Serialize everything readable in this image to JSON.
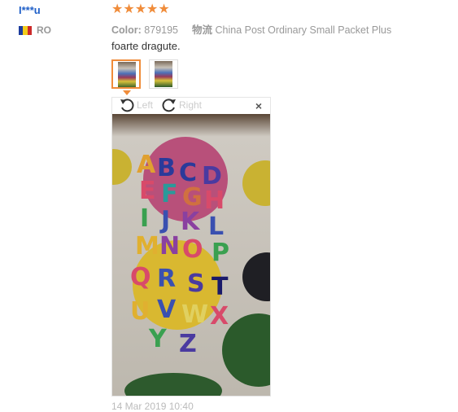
{
  "review": {
    "user_name": "I***u",
    "country_code": "RO",
    "flag_colors": [
      "#1d3c9e",
      "#f2cc1a",
      "#cc2a2a"
    ],
    "rating": 5,
    "star_color": "#f08c3a",
    "color_label": "Color:",
    "color_value": "879195",
    "shipping_label": "物流",
    "shipping_value": "China Post Ordinary Small Packet Plus",
    "text": "foarte dragute.",
    "date": "14 Mar 2019 10:40"
  },
  "gallery": {
    "thumbnails": [
      {
        "icon": "photo-thumbnail",
        "selected": true
      },
      {
        "icon": "photo-thumbnail",
        "selected": false
      }
    ],
    "accent_color": "#f08c3a"
  },
  "viewer": {
    "rotate_left_label": "Left",
    "rotate_right_label": "Right",
    "close_symbol": "×"
  }
}
